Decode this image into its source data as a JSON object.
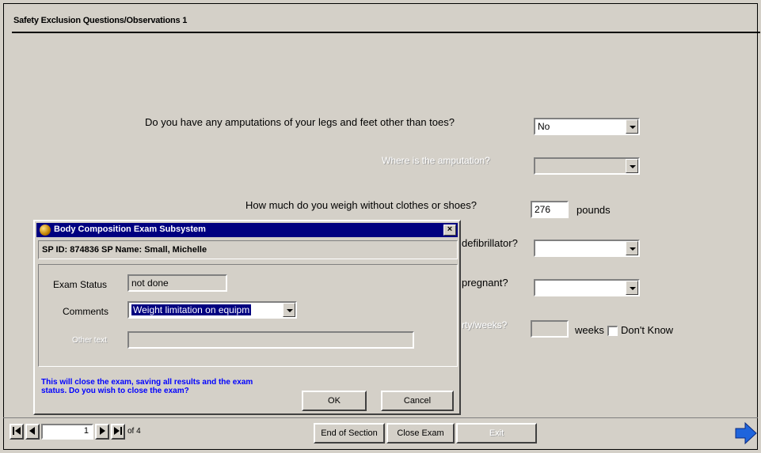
{
  "section": {
    "title": "Safety Exclusion Questions/Observations 1"
  },
  "questions": [
    {
      "text": "Do you have any amputations of your legs and feet other than toes?",
      "value": "No"
    },
    {
      "text": "Where is the amputation?",
      "value": ""
    },
    {
      "text": "How much do you weigh without clothes or shoes?",
      "value": "276",
      "unit": "pounds"
    },
    {
      "text": "defibrillator?",
      "value": ""
    },
    {
      "text": "pregnant?",
      "value": ""
    },
    {
      "text": "rty/weeks?",
      "value": "",
      "unit": "weeks",
      "dont_know": "Don't Know"
    }
  ],
  "dialog": {
    "title": "Body Composition Exam Subsystem",
    "close_glyph": "×",
    "sp_info": "SP ID: 874836  SP Name: Small, Michelle",
    "exam_status_label": "Exam Status",
    "exam_status_value": "not done",
    "comments_label": "Comments",
    "comments_value": "Weight limitation on equipm",
    "other_label": "Other text",
    "other_value": "",
    "note": "This will close the exam, saving all results and the exam status. Do you wish to close the exam?",
    "ok_label": "OK",
    "cancel_label": "Cancel"
  },
  "navigation": {
    "page_value": "1",
    "page_total": "of 4",
    "end_section_label": "End of Section",
    "close_exam_label": "Close Exam",
    "third_button_label": "Exit"
  },
  "colors": {
    "titlebar": "#000080",
    "note": "#0000ff",
    "selection": "#000080",
    "next_arrow": "#1e64dc"
  }
}
